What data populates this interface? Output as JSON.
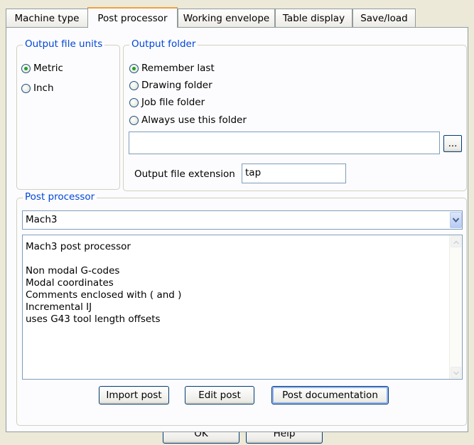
{
  "tabs": [
    {
      "label": "Machine type"
    },
    {
      "label": "Post processor"
    },
    {
      "label": "Working envelope"
    },
    {
      "label": "Table display"
    },
    {
      "label": "Save/load"
    }
  ],
  "active_tab": "Post processor",
  "output_units": {
    "legend": "Output file units",
    "options": [
      {
        "label": "Metric",
        "checked": true
      },
      {
        "label": "Inch",
        "checked": false
      }
    ]
  },
  "output_folder": {
    "legend": "Output folder",
    "options": [
      {
        "label": "Remember last",
        "checked": true
      },
      {
        "label": "Drawing folder",
        "checked": false
      },
      {
        "label": "Job file folder",
        "checked": false
      },
      {
        "label": "Always use this folder",
        "checked": false
      }
    ],
    "folder_path": "",
    "browse_label": "...",
    "extension_label": "Output file extension",
    "extension_value": "tap"
  },
  "post_processor": {
    "legend": "Post processor",
    "selected": "Mach3",
    "description": "Mach3 post processor\n\nNon modal G-codes\nModal coordinates\nComments enclosed with ( and )\nIncremental IJ\nuses G43 tool length offsets",
    "import_label": "Import post",
    "edit_label": "Edit post",
    "docs_label": "Post documentation"
  },
  "footer": {
    "ok_label": "OK",
    "help_label": "Help"
  }
}
